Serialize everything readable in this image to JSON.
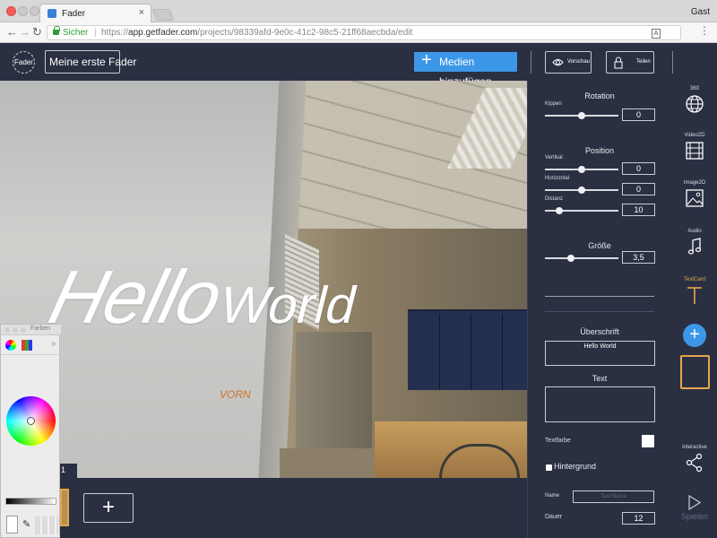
{
  "browser": {
    "tab_title": "Fader",
    "tab_close": "×",
    "profile": "Gast",
    "url_secure_label": "Sicher",
    "url_sep": "|",
    "url_scheme": "https://",
    "url_host": "app.getfader.com",
    "url_path": "/projects/98339afd-9e0c-41c2-98c5-21ff68aecbda/edit"
  },
  "header": {
    "logo_text": "Fader",
    "project_name": "Meine erste Fader",
    "add_media_label": "Medien hinzufügen",
    "preview_label": "Vorschau",
    "share_label": "Teilen"
  },
  "scene": {
    "hello_line1": "Hello",
    "hello_line2": "World",
    "direction_label": "VORN"
  },
  "color_picker": {
    "title": "Farben"
  },
  "timeline": {
    "clip_number": "1",
    "add_label": "+"
  },
  "properties": {
    "rotation": {
      "title": "Rotation",
      "tilt_label": "Kippen",
      "tilt_value": "0",
      "tilt_level": 0.5
    },
    "position": {
      "title": "Position",
      "vertical_label": "Vertikal",
      "vertical_value": "0",
      "vertical_level": 0.5,
      "horizontal_label": "Horizontal",
      "horizontal_value": "0",
      "horizontal_level": 0.5,
      "distance_label": "Distanz",
      "distance_value": "10",
      "distance_level": 0.2
    },
    "size": {
      "title": "Größe",
      "value": "3,5",
      "level": 0.35
    },
    "heading": {
      "title": "Überschrift",
      "value": "Hello World"
    },
    "text": {
      "title": "Text",
      "value": ""
    },
    "text_color_label": "Textfarbe",
    "text_color": "#ffffff",
    "background_label": "Hintergrund",
    "name_label": "Name",
    "name_placeholder": "Text Name",
    "duration_label": "Dauer",
    "duration_value": "12"
  },
  "assets": {
    "items": [
      {
        "label": "360",
        "icon": "globe-icon"
      },
      {
        "label": "Video2D",
        "icon": "film-icon"
      },
      {
        "label": "Image2D",
        "icon": "image-icon"
      },
      {
        "label": "Audio",
        "icon": "music-note-icon"
      },
      {
        "label": "TextCard",
        "icon": "text-t-icon"
      }
    ],
    "add_label": "+",
    "interactive_label": "Interactive",
    "interactive_icon": "share-nodes-icon",
    "play_label": "Spielen"
  },
  "colors": {
    "background": "#2a3042",
    "accent_blue": "#3d97e8",
    "accent_orange": "#e6a64a"
  }
}
